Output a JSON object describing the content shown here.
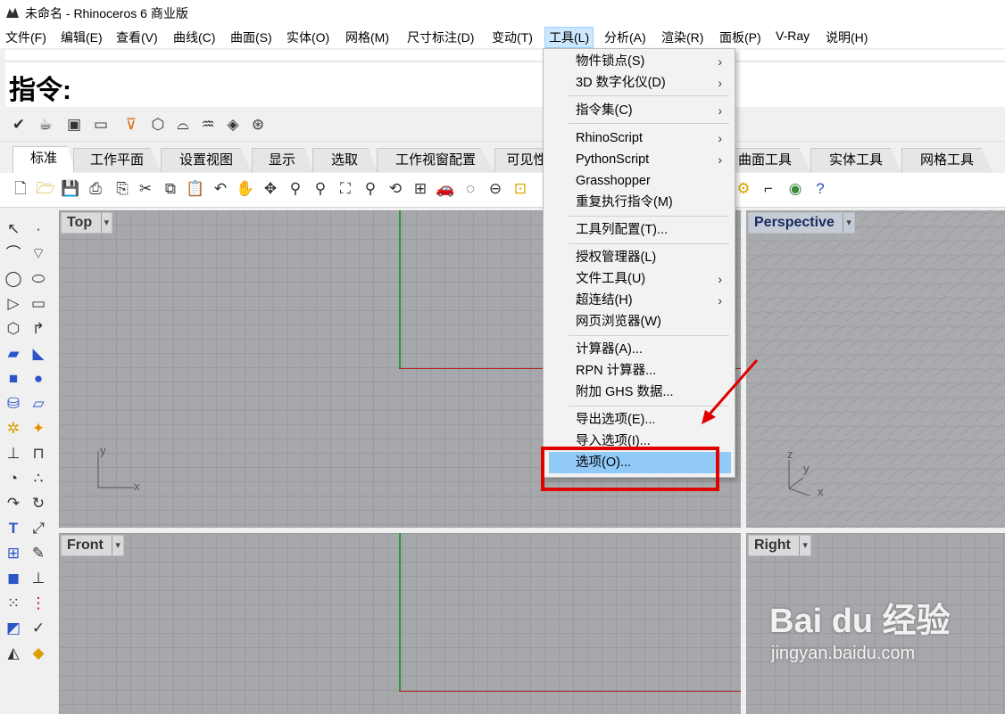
{
  "window": {
    "title": "未命名 - Rhinoceros 6 商业版"
  },
  "menubar": {
    "items": [
      "文件(F)",
      "编辑(E)",
      "查看(V)",
      "曲线(C)",
      "曲面(S)",
      "实体(O)",
      "网格(M)",
      "尺寸标注(D)",
      "变动(T)",
      "工具(L)",
      "分析(A)",
      "渲染(R)",
      "面板(P)",
      "V-Ray",
      "说明(H)"
    ],
    "active": "工具(L)"
  },
  "command": {
    "prompt": "指令:"
  },
  "tabs": [
    "标准",
    "工作平面",
    "设置视图",
    "显示",
    "选取",
    "工作视窗配置",
    "可见性",
    "曲面工具",
    "实体工具",
    "网格工具"
  ],
  "viewports": {
    "top": "Top",
    "perspective": "Perspective",
    "front": "Front",
    "right": "Right"
  },
  "axes": {
    "x": "x",
    "y": "y",
    "z": "z"
  },
  "tools_menu": {
    "items": [
      {
        "label": "物件锁点(S)",
        "submenu": "›"
      },
      {
        "label": "3D 数字化仪(D)",
        "submenu": "›"
      },
      {
        "label": "指令集(C)",
        "submenu": "›"
      },
      {
        "label": "RhinoScript",
        "submenu": "›"
      },
      {
        "label": "PythonScript",
        "submenu": "›"
      },
      {
        "label": "Grasshopper"
      },
      {
        "label": "重复执行指令(M)"
      },
      {
        "label": "工具列配置(T)..."
      },
      {
        "label": "授权管理器(L)"
      },
      {
        "label": "文件工具(U)",
        "submenu": "›"
      },
      {
        "label": "超连结(H)",
        "submenu": "›"
      },
      {
        "label": "网页浏览器(W)"
      },
      {
        "label": "计算器(A)..."
      },
      {
        "label": "RPN 计算器..."
      },
      {
        "label": "附加 GHS 数据..."
      },
      {
        "label": "导出选项(E)..."
      },
      {
        "label": "导入选项(I)..."
      },
      {
        "label": "选项(O)..."
      }
    ],
    "highlighted": "选项(O)..."
  },
  "watermark": {
    "brand": "Bai du 经验",
    "url": "jingyan.baidu.com"
  },
  "colors": {
    "menu_highlight": "#91c9f7",
    "annotation_red": "#e00000",
    "x_axis": "#b52222",
    "y_axis": "#2a9d2a"
  }
}
